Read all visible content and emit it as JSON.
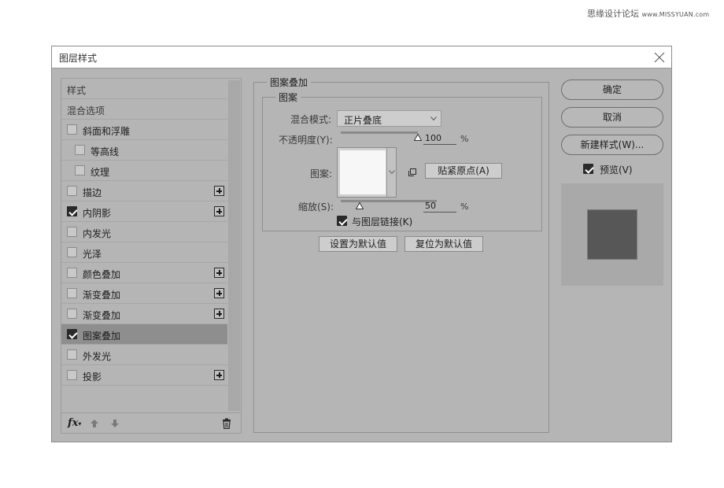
{
  "watermark": {
    "cn": "思缘设计论坛",
    "url": "www.MISSYUAN.com"
  },
  "dialog": {
    "title": "图层样式"
  },
  "style_list": {
    "items": [
      {
        "label": "样式",
        "checkbox": false,
        "checked": false,
        "plus": false,
        "indent": 0
      },
      {
        "label": "混合选项",
        "checkbox": false,
        "checked": false,
        "plus": false,
        "indent": 0
      },
      {
        "label": "斜面和浮雕",
        "checkbox": true,
        "checked": false,
        "plus": false,
        "indent": 0
      },
      {
        "label": "等高线",
        "checkbox": true,
        "checked": false,
        "plus": false,
        "indent": 1
      },
      {
        "label": "纹理",
        "checkbox": true,
        "checked": false,
        "plus": false,
        "indent": 1
      },
      {
        "label": "描边",
        "checkbox": true,
        "checked": false,
        "plus": true,
        "indent": 0
      },
      {
        "label": "内阴影",
        "checkbox": true,
        "checked": true,
        "plus": true,
        "indent": 0
      },
      {
        "label": "内发光",
        "checkbox": true,
        "checked": false,
        "plus": false,
        "indent": 0
      },
      {
        "label": "光泽",
        "checkbox": true,
        "checked": false,
        "plus": false,
        "indent": 0
      },
      {
        "label": "颜色叠加",
        "checkbox": true,
        "checked": false,
        "plus": true,
        "indent": 0
      },
      {
        "label": "渐变叠加",
        "checkbox": true,
        "checked": false,
        "plus": true,
        "indent": 0
      },
      {
        "label": "渐变叠加",
        "checkbox": true,
        "checked": false,
        "plus": true,
        "indent": 0
      },
      {
        "label": "图案叠加",
        "checkbox": true,
        "checked": true,
        "plus": false,
        "indent": 0,
        "active": true
      },
      {
        "label": "外发光",
        "checkbox": true,
        "checked": false,
        "plus": false,
        "indent": 0
      },
      {
        "label": "投影",
        "checkbox": true,
        "checked": false,
        "plus": true,
        "indent": 0
      }
    ],
    "footer": {
      "fx_label": "fx"
    }
  },
  "overlay": {
    "group_title": "图案叠加",
    "subgroup_title": "图案",
    "blend_label": "混合模式:",
    "blend_value": "正片叠底",
    "opacity_label": "不透明度(Y):",
    "opacity_value": "100",
    "opacity_pct": 100,
    "pattern_label": "图案:",
    "snap_button": "贴紧原点(A)",
    "scale_label": "缩放(S):",
    "scale_value": "50",
    "scale_pct": 50,
    "percent_sign": "%",
    "link_label": "与图层链接(K)",
    "link_checked": true,
    "set_default": "设置为默认值",
    "reset_default": "复位为默认值"
  },
  "actions": {
    "ok": "确定",
    "cancel": "取消",
    "new_style": "新建样式(W)...",
    "preview_label": "预览(V)",
    "preview_checked": true
  },
  "colors": {
    "dialog_bg": "#b5b5b5",
    "active_row": "#8e8e8e",
    "preview_swatch": "#575757"
  }
}
